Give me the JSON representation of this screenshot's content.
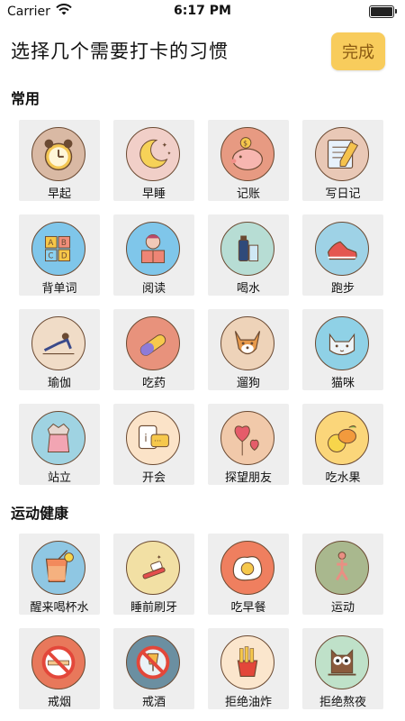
{
  "status": {
    "carrier": "Carrier",
    "time": "6:17 PM"
  },
  "header": {
    "title": "选择几个需要打卡的习惯",
    "done_label": "完成"
  },
  "sections": [
    {
      "title": "常用",
      "items": [
        {
          "label": "早起",
          "icon": "alarm-clock-icon",
          "bg": "#d9b9a4"
        },
        {
          "label": "早睡",
          "icon": "moon-icon",
          "bg": "#f1cfc8"
        },
        {
          "label": "记账",
          "icon": "piggy-bank-icon",
          "bg": "#e79a82"
        },
        {
          "label": "写日记",
          "icon": "notebook-icon",
          "bg": "#e9c8b6"
        },
        {
          "label": "背单词",
          "icon": "abc-blocks-icon",
          "bg": "#7fc6ea"
        },
        {
          "label": "阅读",
          "icon": "reading-icon",
          "bg": "#7fc6ea"
        },
        {
          "label": "喝水",
          "icon": "water-bottle-icon",
          "bg": "#b7ddd4"
        },
        {
          "label": "跑步",
          "icon": "running-shoe-icon",
          "bg": "#9ed2e6"
        },
        {
          "label": "瑜伽",
          "icon": "yoga-icon",
          "bg": "#f0dcc7"
        },
        {
          "label": "吃药",
          "icon": "pill-icon",
          "bg": "#e8927c"
        },
        {
          "label": "遛狗",
          "icon": "dog-icon",
          "bg": "#eed3b9"
        },
        {
          "label": "猫咪",
          "icon": "cat-icon",
          "bg": "#8fd1e6"
        },
        {
          "label": "站立",
          "icon": "standing-icon",
          "bg": "#9fd3e2"
        },
        {
          "label": "开会",
          "icon": "chat-icon",
          "bg": "#fbe3c8"
        },
        {
          "label": "探望朋友",
          "icon": "hearts-icon",
          "bg": "#f1c9aa"
        },
        {
          "label": "吃水果",
          "icon": "lemon-icon",
          "bg": "#fbd67a"
        }
      ]
    },
    {
      "title": "运动健康",
      "items": [
        {
          "label": "醒来喝杯水",
          "icon": "glass-of-water-icon",
          "bg": "#8fc7e3"
        },
        {
          "label": "睡前刷牙",
          "icon": "toothbrush-icon",
          "bg": "#f2e0a4"
        },
        {
          "label": "吃早餐",
          "icon": "fried-egg-icon",
          "bg": "#ef7f5f"
        },
        {
          "label": "运动",
          "icon": "exercise-icon",
          "bg": "#a9b88e"
        },
        {
          "label": "戒烟",
          "icon": "no-smoking-icon",
          "bg": "#e8785b"
        },
        {
          "label": "戒酒",
          "icon": "no-alcohol-icon",
          "bg": "#6b8fa1"
        },
        {
          "label": "拒绝油炸",
          "icon": "fries-icon",
          "bg": "#fbe6cd"
        },
        {
          "label": "拒绝熬夜",
          "icon": "owl-icon",
          "bg": "#bfe1c9"
        }
      ]
    }
  ]
}
